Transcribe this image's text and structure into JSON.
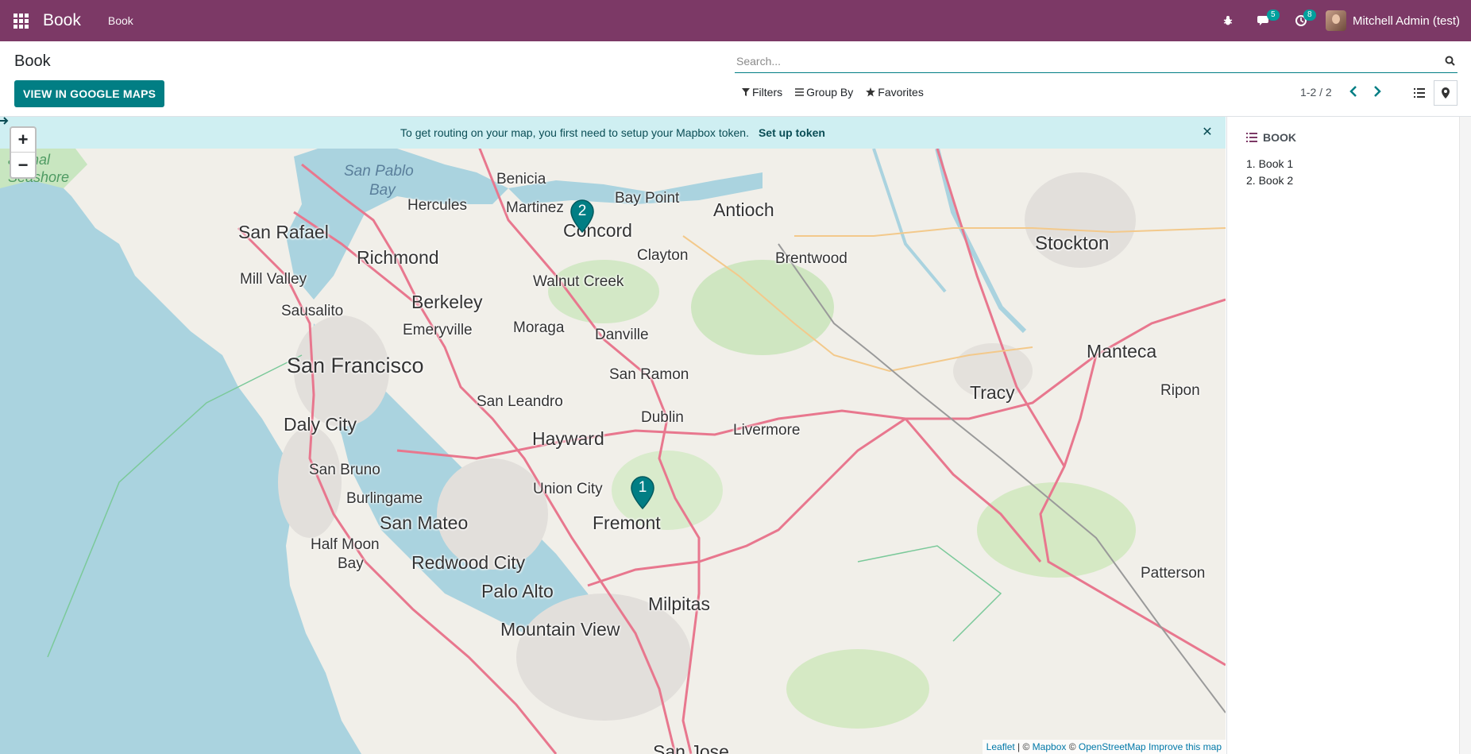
{
  "navbar": {
    "brand": "Book",
    "menu_item": "Book",
    "messages_count": "5",
    "activities_count": "8",
    "user_name": "Mitchell Admin (test)",
    "bg_color": "#7c3966"
  },
  "control_panel": {
    "breadcrumb": "Book",
    "google_maps_button": "VIEW IN GOOGLE MAPS",
    "search_placeholder": "Search...",
    "filters_label": "Filters",
    "group_by_label": "Group By",
    "favorites_label": "Favorites",
    "pager": "1-2 / 2",
    "accent_color": "#017e84"
  },
  "map": {
    "alert_text": "To get routing on your map, you first need to setup your Mapbox token.",
    "alert_link": "Set up token",
    "zoom_in": "+",
    "zoom_out": "−",
    "attribution": {
      "leaflet": "Leaflet",
      "separator": " | © ",
      "mapbox": "Mapbox",
      "copy": " © ",
      "osm": "OpenStreetMap",
      "improve": "Improve this map"
    },
    "labels": {
      "benicia": "Benicia",
      "san_pablo_bay_1": "San Pablo",
      "san_pablo_bay_2": "Bay",
      "bay_point": "Bay Point",
      "antioch": "Antioch",
      "hercules": "Hercules",
      "martinez": "Martinez",
      "concord": "Concord",
      "stockton": "Stockton",
      "san_rafael": "San Rafael",
      "richmond": "Richmond",
      "clayton": "Clayton",
      "brentwood": "Brentwood",
      "mill_valley": "Mill Valley",
      "walnut_creek": "Walnut Creek",
      "berkeley": "Berkeley",
      "sausalito": "Sausalito",
      "emeryville": "Emeryville",
      "moraga": "Moraga",
      "danville": "Danville",
      "manteca": "Manteca",
      "san_francisco": "San Francisco",
      "san_ramon": "San Ramon",
      "tracy": "Tracy",
      "ripon": "Ripon",
      "san_leandro": "San Leandro",
      "daly_city": "Daly City",
      "dublin": "Dublin",
      "livermore": "Livermore",
      "hayward": "Hayward",
      "san_bruno": "San Bruno",
      "union_city": "Union City",
      "burlingame": "Burlingame",
      "san_mateo": "San Mateo",
      "fremont": "Fremont",
      "half_moon_1": "Half Moon",
      "half_moon_2": "Bay",
      "redwood_city": "Redwood City",
      "patterson": "Patterson",
      "palo_alto": "Palo Alto",
      "milpitas": "Milpitas",
      "mountain_view": "Mountain View",
      "national_1": "ational",
      "national_2": "Seashore",
      "san_jose": "San Jose"
    },
    "pins": [
      "2",
      "1"
    ],
    "pin_color": "#017e84"
  },
  "side_panel": {
    "title": "BOOK",
    "items": [
      "1. Book 1",
      "2. Book 2"
    ]
  }
}
